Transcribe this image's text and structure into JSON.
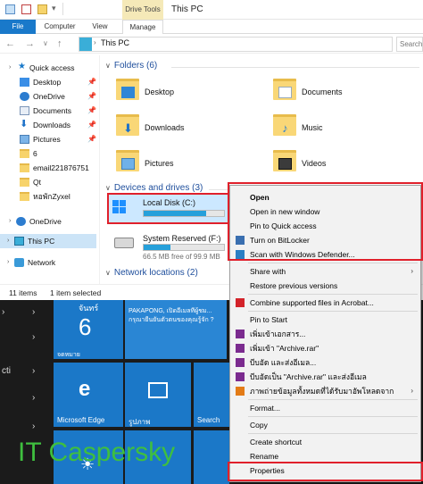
{
  "window": {
    "title": "This PC",
    "context_tab_group": "Drive Tools",
    "ribbon_tabs": [
      "File",
      "Computer",
      "View",
      "Manage"
    ],
    "address_path": "This PC",
    "search_placeholder": "Search"
  },
  "nav": {
    "quick_access": "Quick access",
    "items": [
      {
        "label": "Desktop",
        "pinned": true
      },
      {
        "label": "OneDrive",
        "pinned": true
      },
      {
        "label": "Documents",
        "pinned": true
      },
      {
        "label": "Downloads",
        "pinned": true
      },
      {
        "label": "Pictures",
        "pinned": true
      },
      {
        "label": "6",
        "pinned": false
      },
      {
        "label": "email221876751",
        "pinned": false
      },
      {
        "label": "Qt",
        "pinned": false
      },
      {
        "label": "หอพักZyxel",
        "pinned": false
      }
    ],
    "onedrive": "OneDrive",
    "this_pc": "This PC",
    "network": "Network"
  },
  "content": {
    "folders_header": "Folders (6)",
    "folders": [
      "Desktop",
      "Documents",
      "Downloads",
      "Music",
      "Pictures",
      "Videos"
    ],
    "devices_header": "Devices and drives (3)",
    "drives": [
      {
        "name": "Local Disk (C:)",
        "fill_fraction": 0.78
      },
      {
        "name": "System Reserved (F:)",
        "free_text": "66.5 MB free of 99.9 MB",
        "fill_fraction": 0.33
      }
    ],
    "network_header": "Network locations (2)"
  },
  "status": {
    "items": "11 items",
    "selected": "1 item selected"
  },
  "start": {
    "day_name": "จันทร์",
    "day_number": "6",
    "email_text": "PAKAPONG, เปิดอีเมลที่ผู้ชม... กรุณายืนยันตัวตนของคุณรู้จัก ?",
    "calendar_label": "จดหมาย",
    "edge_label": "Microsoft Edge",
    "photos_label": "รูปภาพ",
    "search_label": "Search",
    "left_label": "cti"
  },
  "context_menu": {
    "items": [
      {
        "label": "Open",
        "bold": true
      },
      {
        "label": "Open in new window"
      },
      {
        "label": "Pin to Quick access"
      },
      {
        "label": "Turn on BitLocker",
        "icon": "shield-icon"
      },
      {
        "label": "Scan with Windows Defender...",
        "icon": "defender-icon"
      },
      {
        "label": "Share with",
        "submenu": true
      },
      {
        "label": "Restore previous versions"
      },
      {
        "label": "Combine supported files in Acrobat...",
        "icon": "acrobat-icon"
      },
      {
        "label": "Pin to Start"
      },
      {
        "label": "เพิ่มเข้าเอกสาร...",
        "icon": "winrar-icon"
      },
      {
        "label": "เพิ่มเข้า \"Archive.rar\"",
        "icon": "winrar-icon"
      },
      {
        "label": "บีบอัด และส่งอีเมล...",
        "icon": "winrar-icon"
      },
      {
        "label": "บีบอัดเป็น \"Archive.rar\" และส่งอีเมล",
        "icon": "winrar-icon"
      },
      {
        "label": "ภาพถ่ายข้อมูลทั้งหมดที่ได้รับมาอัพโหลดจาก",
        "icon": "upload-icon",
        "submenu": true
      },
      {
        "label": "Format..."
      },
      {
        "label": "Copy"
      },
      {
        "label": "Create shortcut"
      },
      {
        "label": "Rename"
      },
      {
        "label": "Properties"
      }
    ]
  },
  "watermark": "IT Caspersky",
  "colors": {
    "accent": "#1979ca",
    "highlight_box": "#e0202b",
    "drive_bar": "#26a0da"
  }
}
